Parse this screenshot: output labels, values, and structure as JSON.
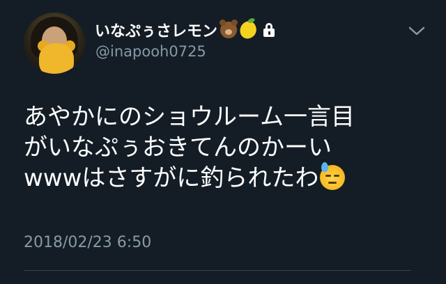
{
  "tweet": {
    "display_name": "いなぷぅさレモン",
    "name_emojis": [
      "bear-face-emoji",
      "lemon-emoji"
    ],
    "protected_icon": "lock-icon",
    "handle": "@inapooh0725",
    "menu_icon": "chevron-down-icon",
    "text": "あやかにのショウルーム一言目\nがいなぷぅおきてんのかーい\nwwwはさすがに釣られたわ",
    "text_emoji": "downcast-face-with-sweat-emoji",
    "timestamp": "2018/02/23 6:50"
  },
  "colors": {
    "background": "#141d26",
    "primary_text": "#ffffff",
    "secondary_text": "#8899a6",
    "divider": "#38444d"
  }
}
